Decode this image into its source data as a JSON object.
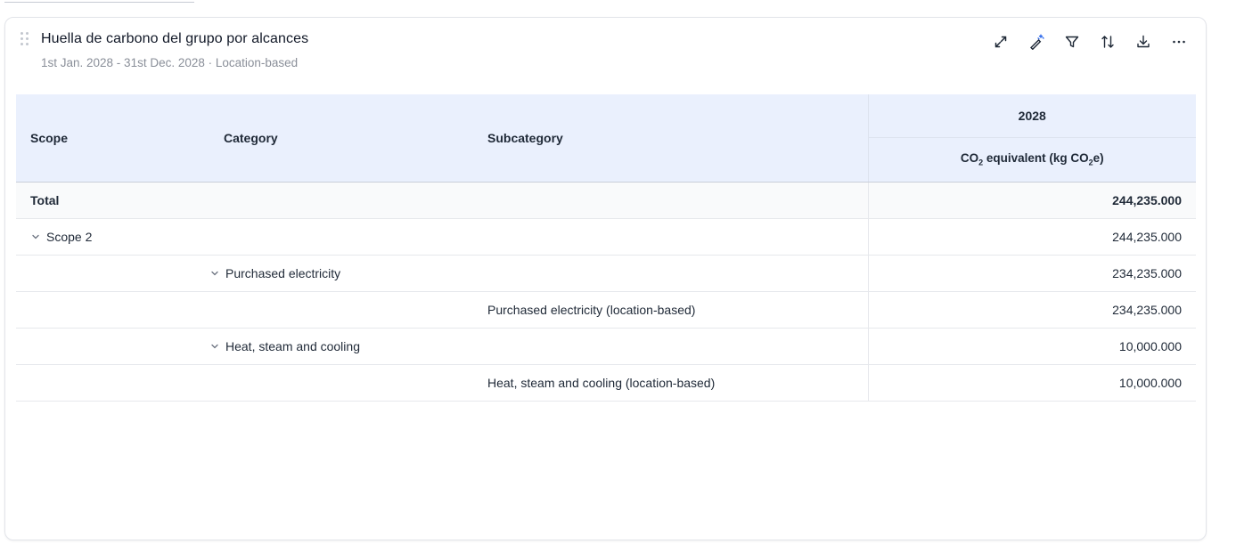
{
  "widget": {
    "title": "Huella de carbono del grupo por alcances",
    "subtitle": "1st Jan. 2028 - 31st Dec. 2028 · Location-based",
    "toolbar_icons": [
      "expand-icon",
      "magic-wand-icon",
      "filter-icon",
      "sort-icon",
      "download-icon",
      "more-icon"
    ]
  },
  "table": {
    "headers": {
      "scope": "Scope",
      "category": "Category",
      "subcategory": "Subcategory",
      "year": "2028",
      "unit_a": "CO",
      "unit_sub1": "2",
      "unit_b": " equivalent (kg CO",
      "unit_sub2": "2",
      "unit_c": "e)"
    },
    "rows": [
      {
        "type": "total",
        "scope": "Total",
        "category": "",
        "subcategory": "",
        "value": "244,235.000"
      },
      {
        "type": "scope",
        "scope": "Scope 2",
        "category": "",
        "subcategory": "",
        "value": "244,235.000"
      },
      {
        "type": "category",
        "scope": "",
        "category": "Purchased electricity",
        "subcategory": "",
        "value": "234,235.000"
      },
      {
        "type": "subcategory",
        "scope": "",
        "category": "",
        "subcategory": "Purchased electricity (location-based)",
        "value": "234,235.000"
      },
      {
        "type": "category",
        "scope": "",
        "category": "Heat, steam and cooling",
        "subcategory": "",
        "value": "10,000.000"
      },
      {
        "type": "subcategory",
        "scope": "",
        "category": "",
        "subcategory": "Heat, steam and cooling (location-based)",
        "value": "10,000.000"
      }
    ]
  },
  "colors": {
    "header_bg": "#eaf0fd",
    "wand_accent": "#2563eb"
  }
}
